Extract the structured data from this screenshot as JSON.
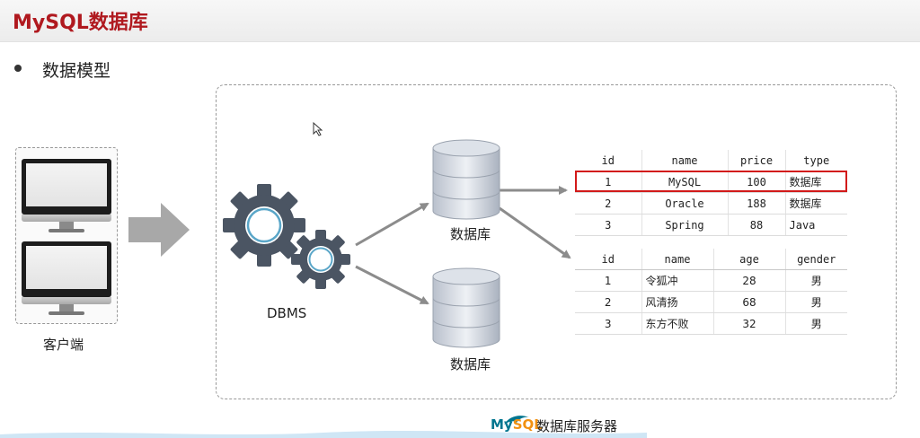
{
  "page": {
    "title": "MySQL数据库",
    "subtitle": "数据模型"
  },
  "client": {
    "label": "客户端"
  },
  "dbms": {
    "label": "DBMS"
  },
  "databases": [
    {
      "label": "数据库"
    },
    {
      "label": "数据库"
    }
  ],
  "table1": {
    "headers": [
      "id",
      "name",
      "price",
      "type"
    ],
    "rows": [
      [
        "1",
        "MySQL",
        "100",
        "数据库"
      ],
      [
        "2",
        "Oracle",
        "188",
        "数据库"
      ],
      [
        "3",
        "Spring",
        "88",
        "Java"
      ]
    ],
    "highlighted_row": 1
  },
  "table2": {
    "headers": [
      "id",
      "name",
      "age",
      "gender"
    ],
    "rows": [
      [
        "1",
        "令狐冲",
        "28",
        "男"
      ],
      [
        "2",
        "风清扬",
        "68",
        "男"
      ],
      [
        "3",
        "东方不败",
        "32",
        "男"
      ]
    ]
  },
  "server": {
    "brand_my": "My",
    "brand_sql": "SQL",
    "label": "数据库服务器"
  },
  "colors": {
    "title": "#b0191f",
    "highlight": "#d21a1a",
    "gear": "#4b5563",
    "arrow": "#8c8c8c"
  }
}
